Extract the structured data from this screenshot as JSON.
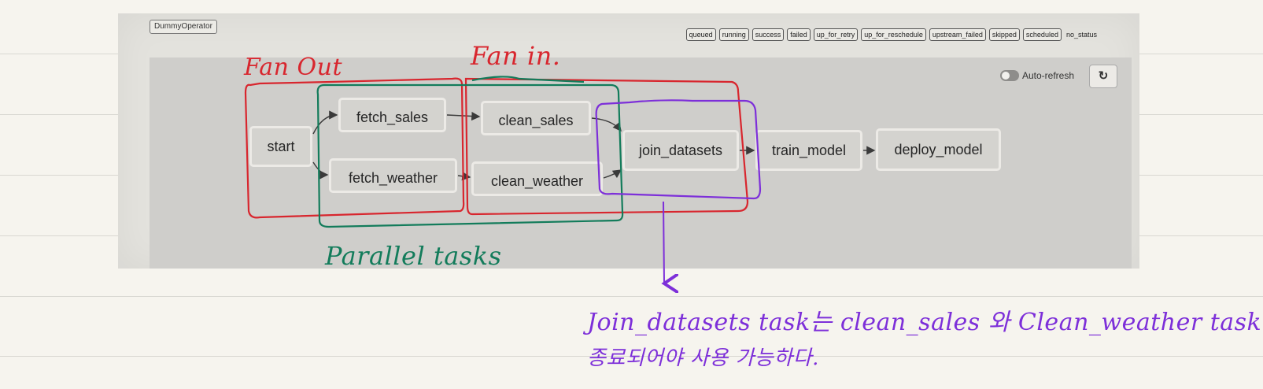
{
  "header": {
    "operator_chip": "DummyOperator"
  },
  "legend": {
    "states": [
      "queued",
      "running",
      "success",
      "failed",
      "up_for_retry",
      "up_for_reschedule",
      "upstream_failed",
      "skipped",
      "scheduled"
    ],
    "no_status": "no_status"
  },
  "controls": {
    "auto_refresh_label": "Auto-refresh",
    "refresh_icon": "refresh-icon"
  },
  "diagram": {
    "nodes": [
      {
        "id": "start",
        "label": "start"
      },
      {
        "id": "fetch_sales",
        "label": "fetch_sales"
      },
      {
        "id": "fetch_weather",
        "label": "fetch_weather"
      },
      {
        "id": "clean_sales",
        "label": "clean_sales"
      },
      {
        "id": "clean_weather",
        "label": "clean_weather"
      },
      {
        "id": "join_datasets",
        "label": "join_datasets"
      },
      {
        "id": "train_model",
        "label": "train_model"
      },
      {
        "id": "deploy_model",
        "label": "deploy_model"
      }
    ],
    "edges": [
      [
        "start",
        "fetch_sales"
      ],
      [
        "start",
        "fetch_weather"
      ],
      [
        "fetch_sales",
        "clean_sales"
      ],
      [
        "fetch_weather",
        "clean_weather"
      ],
      [
        "clean_sales",
        "join_datasets"
      ],
      [
        "clean_weather",
        "join_datasets"
      ],
      [
        "join_datasets",
        "train_model"
      ],
      [
        "train_model",
        "deploy_model"
      ]
    ]
  },
  "annotations": {
    "fan_out": "Fan Out",
    "fan_in": "Fan in.",
    "parallel": "Parallel tasks",
    "note_line1": "Join_datasets task는 clean_sales 와 Clean_weather task가",
    "note_line2": "종료되어야 사용 가능하다.",
    "colors": {
      "red": "#d8262e",
      "green": "#137c5b",
      "purple": "#7d2fd9"
    }
  }
}
